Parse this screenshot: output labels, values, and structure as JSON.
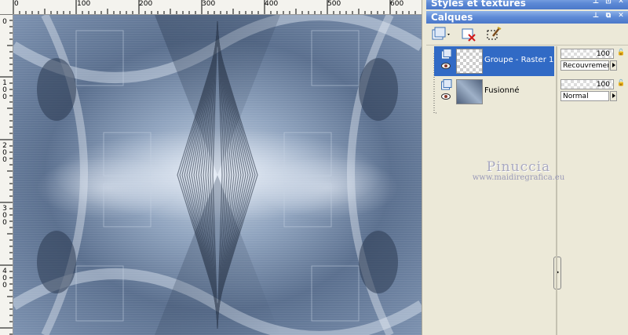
{
  "rulers": {
    "top_labels": [
      "0",
      "100",
      "200",
      "300",
      "400",
      "500",
      "600"
    ],
    "left_labels": [
      "0",
      "100",
      "200",
      "300",
      "400"
    ]
  },
  "panels": {
    "styles_title": "Styles et textures",
    "layers_title": "Calques"
  },
  "layers": [
    {
      "name": "Groupe - Raster 1",
      "opacity": "100",
      "blend": "Recouvrement",
      "selected": true
    },
    {
      "name": "Fusionné",
      "opacity": "100",
      "blend": "Normal",
      "selected": false
    }
  ],
  "watermark": {
    "name": "Pinuccia",
    "url": "www.maidiregrafica.eu"
  },
  "colors": {
    "title_bar": "#5d8ad6",
    "selected_row": "#316ac5",
    "panel_bg": "#ece9d8"
  },
  "icons": [
    "new-layer-icon",
    "delete-layer-icon",
    "edit-selection-icon",
    "eye-icon",
    "group-icon",
    "lock-icon",
    "pin-icon",
    "restore-icon",
    "close-icon"
  ]
}
